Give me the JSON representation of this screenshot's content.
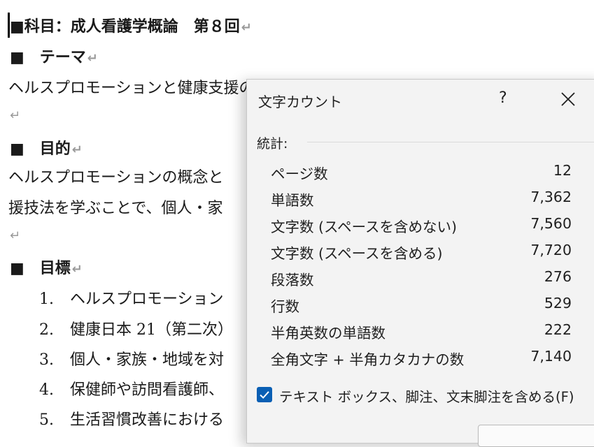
{
  "document": {
    "title_line": "■科目：成人看護学概論　第８回",
    "theme_heading": "■　テーマ",
    "theme_text": "ヘルスプロモーションと健康支援の実践",
    "purpose_heading": "■　目的",
    "purpose_text_1": "ヘルスプロモーションの概念と",
    "purpose_text_2": "援技法を学ぶことで、個人・家",
    "goals_heading": "■　目標",
    "goals": [
      {
        "num": "1.",
        "text": "ヘルスプロモーション"
      },
      {
        "num": "2.",
        "text": "健康日本 21（第二次）"
      },
      {
        "num": "3.",
        "text": "個人・家族・地域を対"
      },
      {
        "num": "4.",
        "text": "保健師や訪問看護師、"
      },
      {
        "num": "5.",
        "text": "生活習慣改善における"
      }
    ],
    "return_mark": "↵"
  },
  "dialog": {
    "title": "文字カウント",
    "help": "?",
    "section_label": "統計:",
    "stats": [
      {
        "label": "ページ数",
        "value": "12"
      },
      {
        "label": "単語数",
        "value": "7,362"
      },
      {
        "label": "文字数 (スペースを含めない)",
        "value": "7,560"
      },
      {
        "label": "文字数 (スペースを含める)",
        "value": "7,720"
      },
      {
        "label": "段落数",
        "value": "276"
      },
      {
        "label": "行数",
        "value": "529"
      },
      {
        "label": "半角英数の単語数",
        "value": "222"
      },
      {
        "label": "全角文字 + 半角カタカナの数",
        "value": "7,140"
      }
    ],
    "checkbox_label": "テキスト ボックス、脚注、文末脚注を含める(F)",
    "checkbox_checked": true,
    "accent_color": "#0a5fb4"
  }
}
